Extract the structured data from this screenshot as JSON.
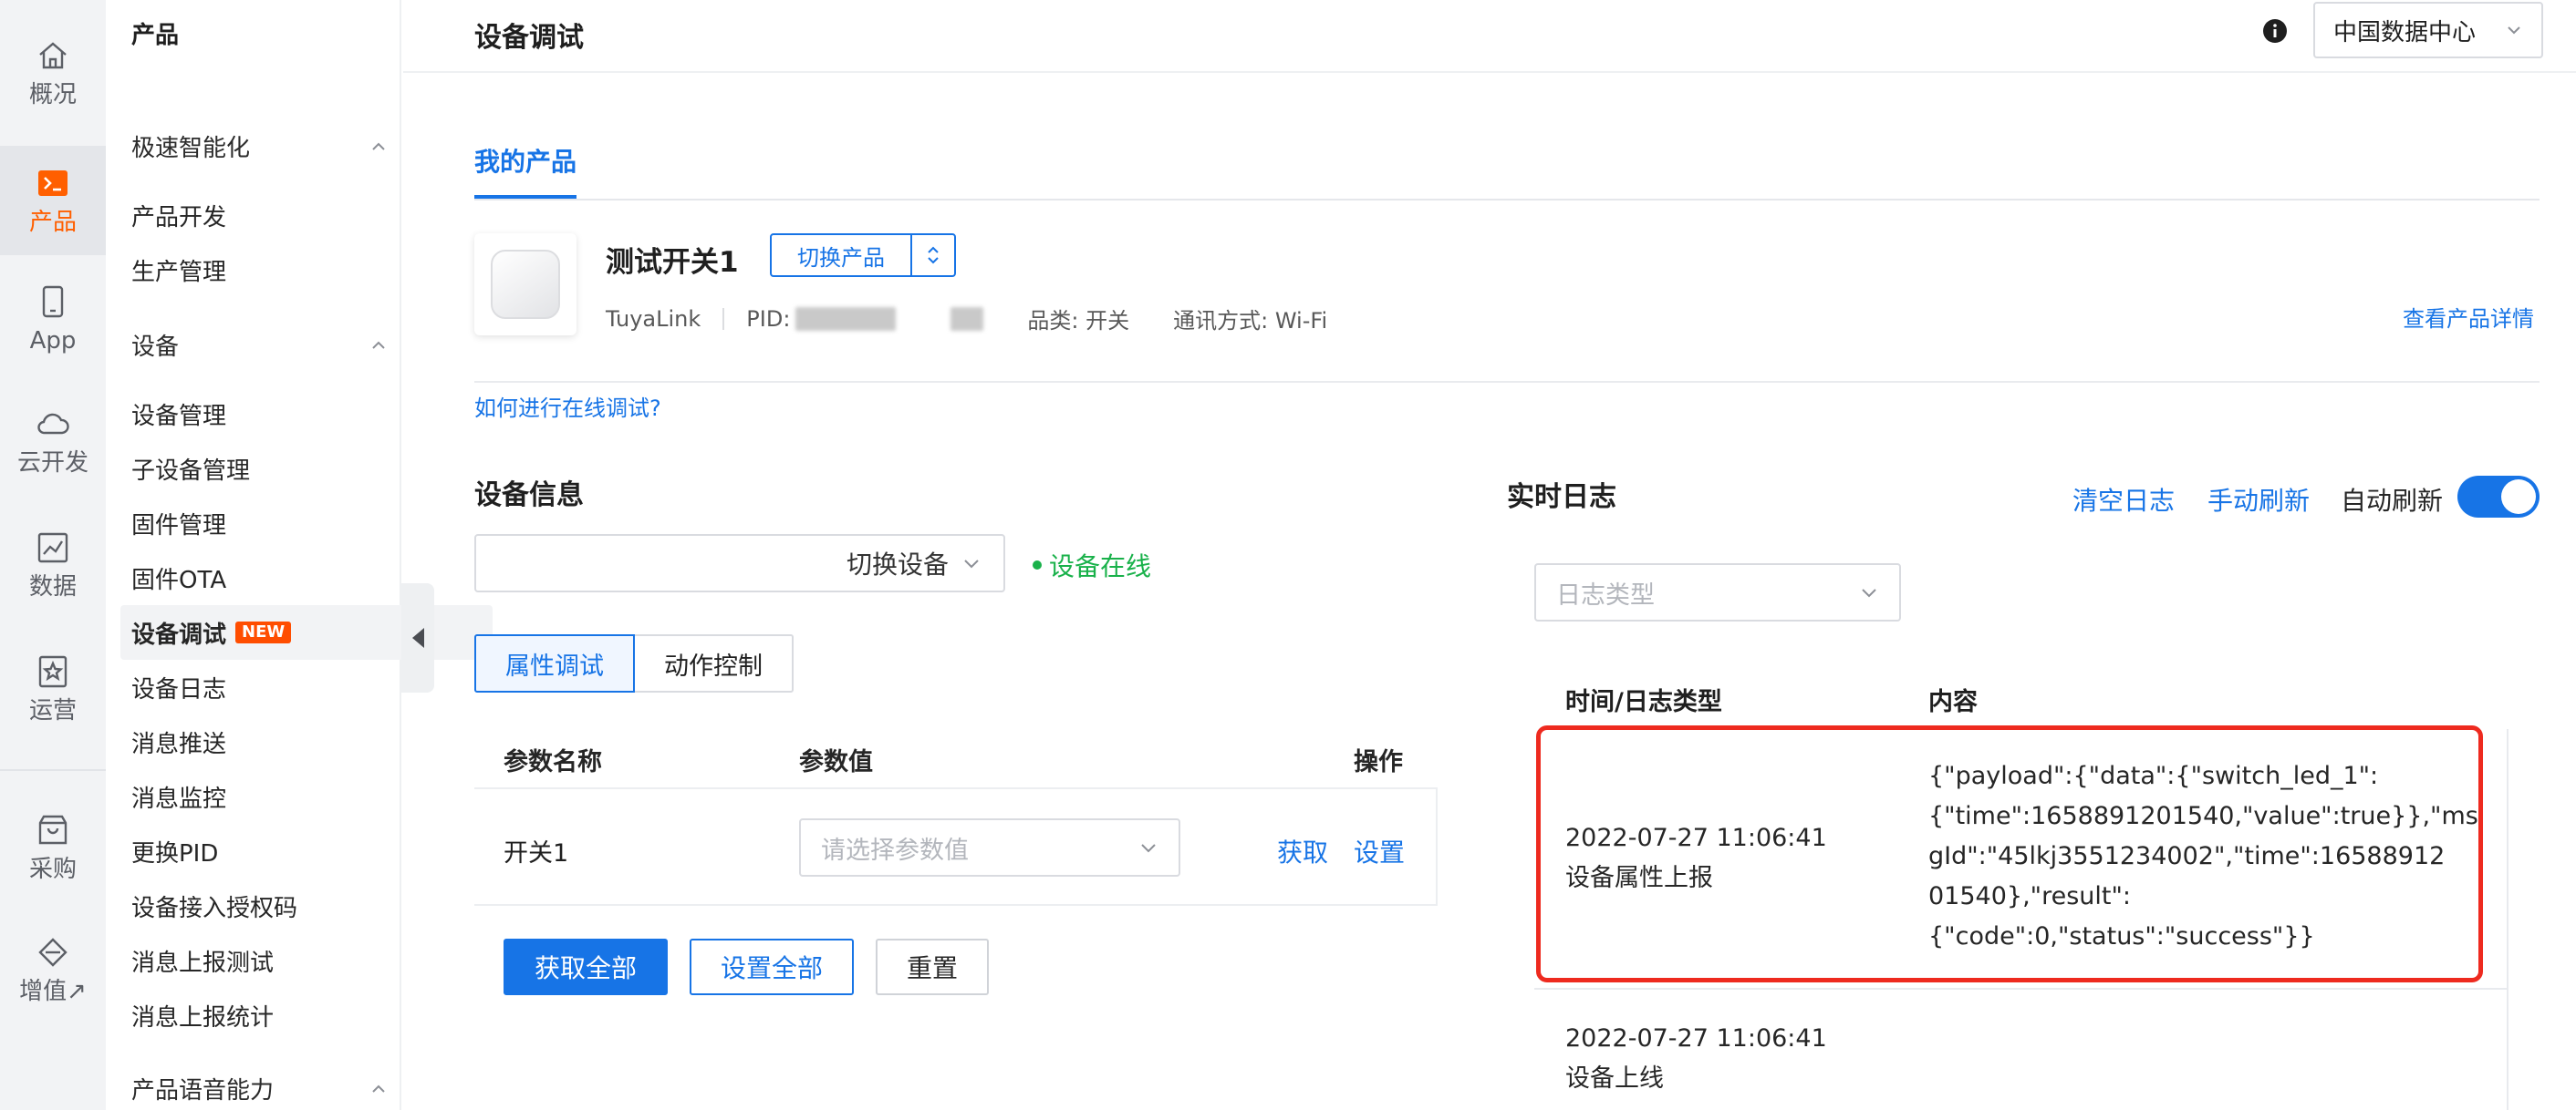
{
  "rail": [
    {
      "label": "概况",
      "icon": "home-icon"
    },
    {
      "label": "产品",
      "icon": "terminal-icon",
      "active": true
    },
    {
      "label": "App",
      "icon": "phone-icon"
    },
    {
      "label": "云开发",
      "icon": "cloud-icon"
    },
    {
      "label": "数据",
      "icon": "chart-icon"
    },
    {
      "label": "运营",
      "icon": "star-icon"
    },
    {
      "label": "采购",
      "icon": "shop-icon"
    },
    {
      "label": "增值↗",
      "icon": "diamond-icon"
    }
  ],
  "sidebar": {
    "title": "产品",
    "groups": [
      "极速智能化",
      "设备",
      "产品语音能力"
    ],
    "items": [
      "产品开发",
      "生产管理",
      "设备管理",
      "子设备管理",
      "固件管理",
      "固件OTA",
      "设备调试",
      "设备日志",
      "消息推送",
      "消息监控",
      "更换PID",
      "设备接入授权码",
      "消息上报测试",
      "消息上报统计"
    ],
    "new_badge": "NEW",
    "active_item": "设备调试"
  },
  "header": {
    "title": "设备调试",
    "region": "中国数据中心"
  },
  "main": {
    "tab": "我的产品",
    "product": {
      "name": "测试开关1",
      "switch_label": "切换产品",
      "platform": "TuyaLink",
      "pid_label": "PID:",
      "category": "品类:  开关",
      "comm": "通讯方式:  Wi-Fi",
      "detail_link": "查看产品详情"
    },
    "howto_link": "如何进行在线调试?",
    "device_info": {
      "title": "设备信息",
      "switch_device": "切换设备",
      "status": "设备在线",
      "tabs": [
        "属性调试",
        "动作控制"
      ],
      "columns": [
        "参数名称",
        "参数值",
        "操作"
      ],
      "row": {
        "name": "开关1",
        "placeholder": "请选择参数值",
        "get": "获取",
        "set": "设置"
      },
      "buttons": {
        "get_all": "获取全部",
        "set_all": "设置全部",
        "reset": "重置"
      }
    },
    "log": {
      "title": "实时日志",
      "clear": "清空日志",
      "refresh": "手动刷新",
      "auto_refresh": "自动刷新",
      "auto_refresh_on": true,
      "type_placeholder": "日志类型",
      "columns": [
        "时间/日志类型",
        "内容"
      ],
      "rows": [
        {
          "time": "2022-07-27 11:06:41",
          "type": "设备属性上报",
          "content": "{\"payload\":{\"data\":{\"switch_led_1\":\n{\"time\":1658891201540,\"value\":true}},\"ms\ngId\":\"45lkj3551234002\",\"time\":16588912\n01540},\"result\":\n{\"code\":0,\"status\":\"success\"}}"
        },
        {
          "time": "2022-07-27 11:06:41",
          "type": "设备上线",
          "content": ""
        }
      ]
    }
  },
  "colors": {
    "accent": "#1774e6",
    "brand_active": "#ff5f00",
    "online": "#19b14a",
    "highlight": "#ee2a1f",
    "new_badge": "#ff4d00"
  }
}
